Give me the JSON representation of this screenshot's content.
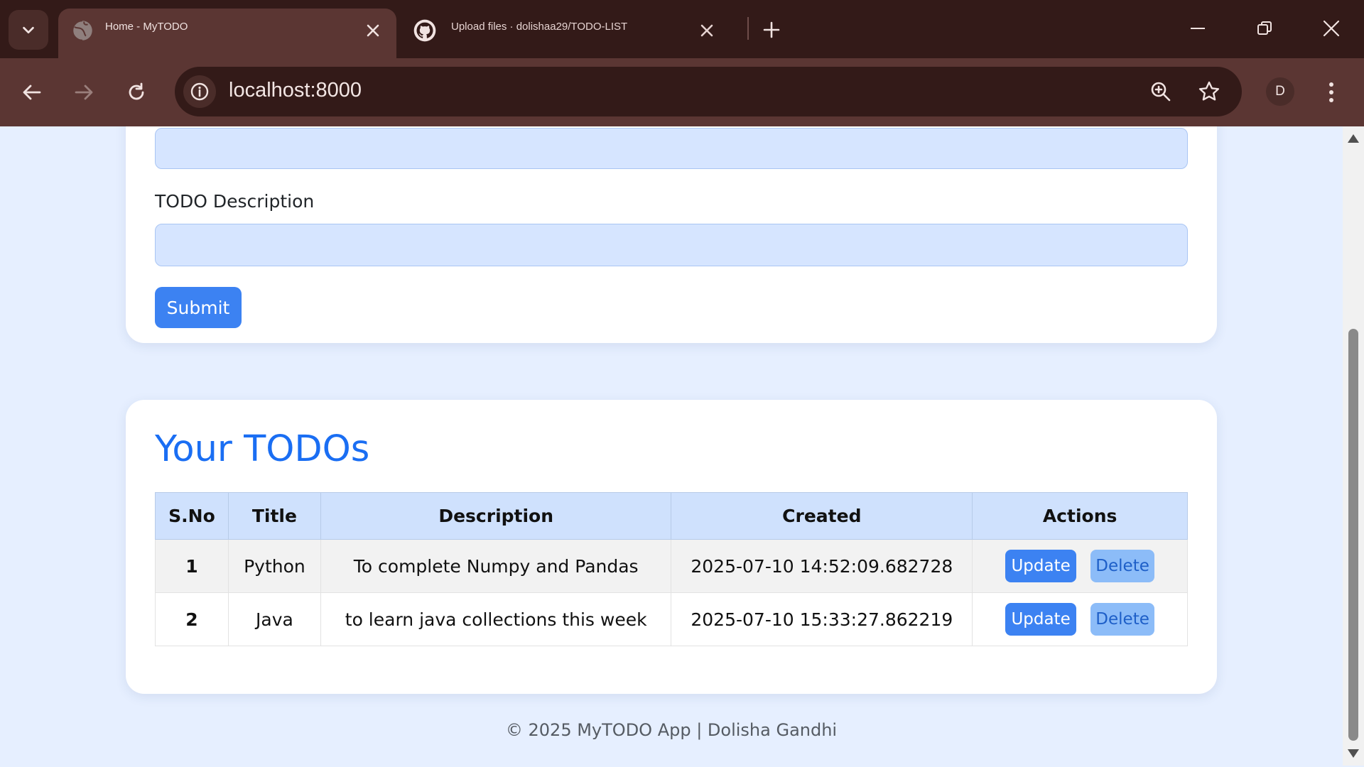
{
  "browser": {
    "tabs": [
      {
        "title": "Home - MyTODO",
        "favicon": "globe-icon",
        "active": true
      },
      {
        "title": "Upload files · dolishaa29/TODO-LIST",
        "favicon": "github-icon",
        "active": false
      }
    ],
    "url": "localhost:8000",
    "profile_initial": "D"
  },
  "form": {
    "description_label": "TODO Description",
    "submit_label": "Submit"
  },
  "todos": {
    "heading": "Your TODOs",
    "columns": [
      "S.No",
      "Title",
      "Description",
      "Created",
      "Actions"
    ],
    "rows": [
      {
        "sno": "1",
        "title": "Python",
        "description": "To complete Numpy and Pandas",
        "created": "2025-07-10 14:52:09.682728",
        "update_label": "Update",
        "delete_label": "Delete"
      },
      {
        "sno": "2",
        "title": "Java",
        "description": "to learn java collections this week",
        "created": "2025-07-10 15:33:27.862219",
        "update_label": "Update",
        "delete_label": "Delete"
      }
    ]
  },
  "footer": {
    "text": "© 2025 MyTODO App | Dolisha Gandhi"
  },
  "colors": {
    "accent": "#1a6ef3",
    "button_primary": "#3c82f2",
    "button_secondary": "#8cbcf8",
    "page_background": "#e6efff",
    "browser_frame": "#331a18"
  }
}
